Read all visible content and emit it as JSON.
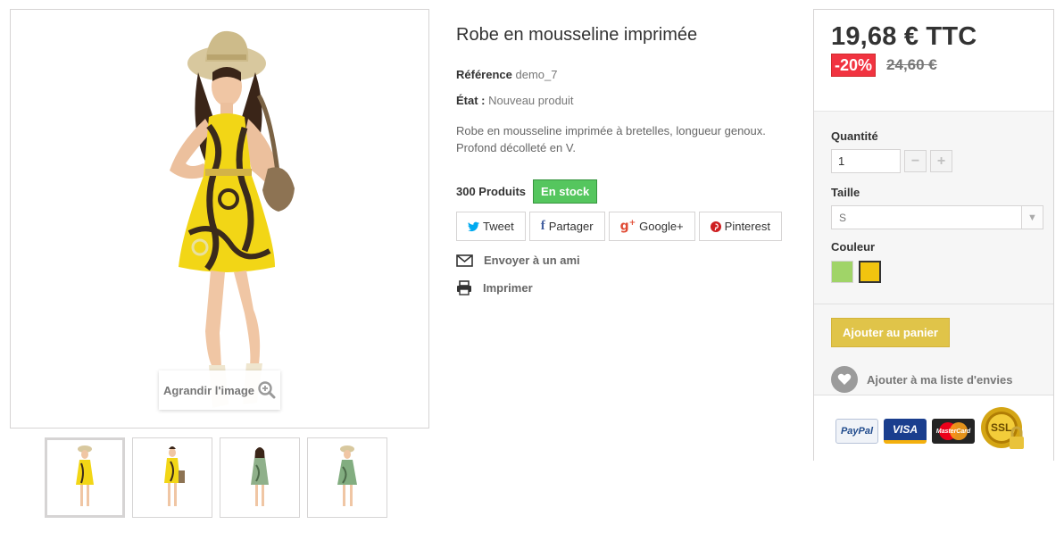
{
  "product": {
    "title": "Robe en mousseline imprimée",
    "reference_label": "Référence",
    "reference_value": "demo_7",
    "condition_label": "État :",
    "condition_value": "Nouveau produit",
    "description": "Robe en mousseline imprimée à bretelles, longueur genoux. Profond décolleté en V.",
    "quantity_available": "300 Produits",
    "stock_status": "En stock",
    "zoom_label": "Agrandir l'image"
  },
  "share": [
    {
      "icon": "twitter-icon",
      "label": "Tweet",
      "color": "#00aaf0"
    },
    {
      "icon": "facebook-icon",
      "label": "Partager",
      "color": "#435f9f"
    },
    {
      "icon": "google-plus-icon",
      "label": "Google+",
      "color": "#e04b34"
    },
    {
      "icon": "pinterest-icon",
      "label": "Pinterest",
      "color": "#ce1f21"
    }
  ],
  "actions": {
    "send_friend": "Envoyer à un ami",
    "print": "Imprimer"
  },
  "buybox": {
    "price": "19,68 € TTC",
    "discount": "-20%",
    "old_price": "24,60 €",
    "quantity_label": "Quantité",
    "quantity_value": "1",
    "size_label": "Taille",
    "size_selected": "S",
    "color_label": "Couleur",
    "colors": [
      {
        "name": "green",
        "hex": "#a0d468",
        "selected": false
      },
      {
        "name": "yellow",
        "hex": "#f1c40f",
        "selected": true
      }
    ],
    "add_to_cart": "Ajouter au panier",
    "wishlist": "Ajouter à ma liste d'envies"
  },
  "payment_logos": [
    "PayPal",
    "VISA",
    "MasterCard",
    "SSL"
  ],
  "colors": {
    "accent_cart": "#e0c449",
    "stock_green": "#55c65e",
    "discount_red": "#f13340"
  },
  "thumbnails": [
    {
      "name": "thumb-1",
      "selected": true
    },
    {
      "name": "thumb-2",
      "selected": false
    },
    {
      "name": "thumb-3",
      "selected": false
    },
    {
      "name": "thumb-4",
      "selected": false
    }
  ]
}
